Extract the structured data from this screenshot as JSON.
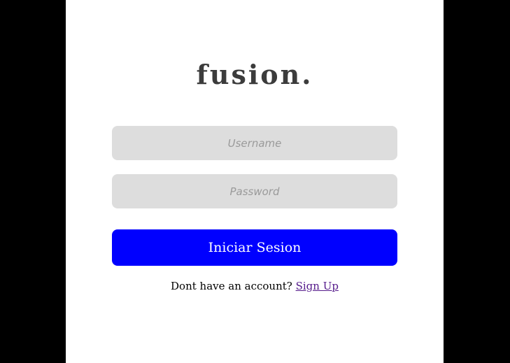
{
  "brand": {
    "logo_text": "fusion."
  },
  "login_form": {
    "username_placeholder": "Username",
    "password_placeholder": "Password",
    "submit_label": "Iniciar Sesion"
  },
  "signup": {
    "prompt": "Dont have an account?",
    "link_label": "Sign Up"
  },
  "colors": {
    "page_background": "#000000",
    "panel_background": "#ffffff",
    "field_background": "#dddddd",
    "button_background": "#0000ff",
    "link_color": "#551a8b"
  }
}
